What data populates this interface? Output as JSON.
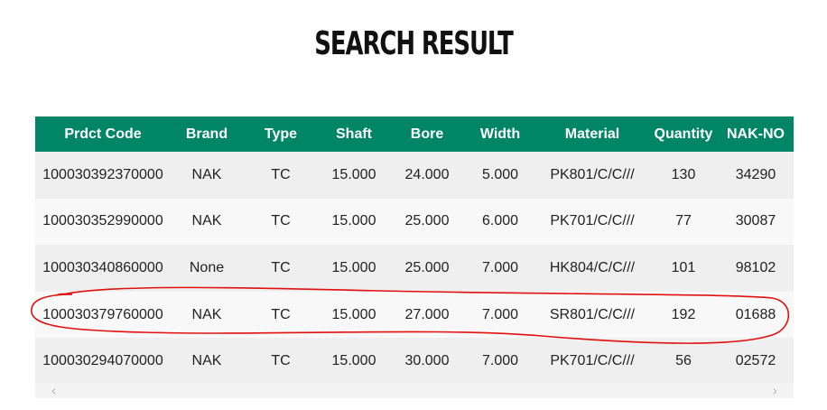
{
  "page": {
    "title": "Search Result"
  },
  "table": {
    "columns": [
      "Prdct Code",
      "Brand",
      "Type",
      "Shaft",
      "Bore",
      "Width",
      "Material",
      "Quantity",
      "NAK-NO"
    ],
    "rows": [
      [
        "100030392370000",
        "NAK",
        "TC",
        "15.000",
        "24.000",
        "5.000",
        "PK801/C/C///",
        "130",
        "34290"
      ],
      [
        "100030352990000",
        "NAK",
        "TC",
        "15.000",
        "25.000",
        "6.000",
        "PK701/C/C///",
        "77",
        "30087"
      ],
      [
        "100030340860000",
        "None",
        "TC",
        "15.000",
        "25.000",
        "7.000",
        "HK804/C/C///",
        "101",
        "98102"
      ],
      [
        "100030379760000",
        "NAK",
        "TC",
        "15.000",
        "27.000",
        "7.000",
        "SR801/C/C///",
        "192",
        "01688"
      ],
      [
        "100030294070000",
        "NAK",
        "TC",
        "15.000",
        "30.000",
        "7.000",
        "PK701/C/C///",
        "56",
        "02572"
      ]
    ],
    "highlighted_row": 3
  },
  "scrollbar": {
    "left_glyph": "‹",
    "right_glyph": "›"
  },
  "colors": {
    "header_bg": "#008566",
    "header_text": "#ffffff",
    "row_odd": "#efefef",
    "row_even": "#f8f8f8",
    "annotation": "#e01010"
  }
}
